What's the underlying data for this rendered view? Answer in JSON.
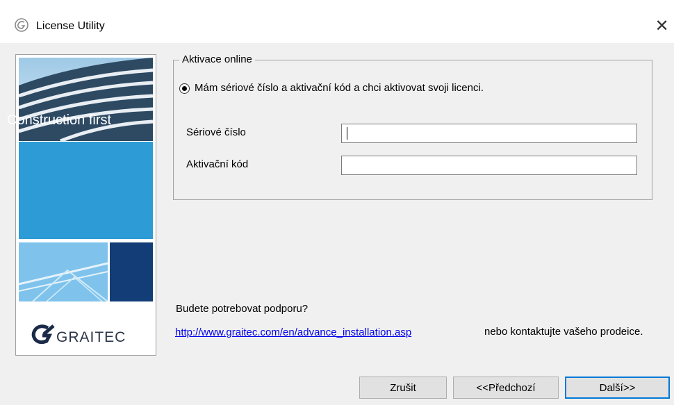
{
  "window": {
    "title": "License Utility",
    "close_symbol": "✕"
  },
  "side_panel": {
    "tagline": "Construction first",
    "logo_text": "GRAITEC"
  },
  "activation": {
    "group_title": "Aktivace online",
    "radio_label": "Mám sériové číslo a aktivační kód a chci aktivovat svoji licenci.",
    "serial_label": "Sériové číslo",
    "serial_value": "",
    "code_label": "Aktivační kód",
    "code_value": ""
  },
  "support": {
    "question": "Budete potrebovat podporu?",
    "link": "http://www.graitec.com/en/advance_installation.asp",
    "contact": "nebo kontaktujte vašeho prodeice."
  },
  "buttons": {
    "cancel": "Zrušit",
    "previous": "<<Předchozí",
    "next": "Další>>"
  },
  "colors": {
    "brand_blue": "#2c9bd6",
    "navy": "#123d77",
    "link": "#0000ee",
    "focus": "#0078d7"
  }
}
